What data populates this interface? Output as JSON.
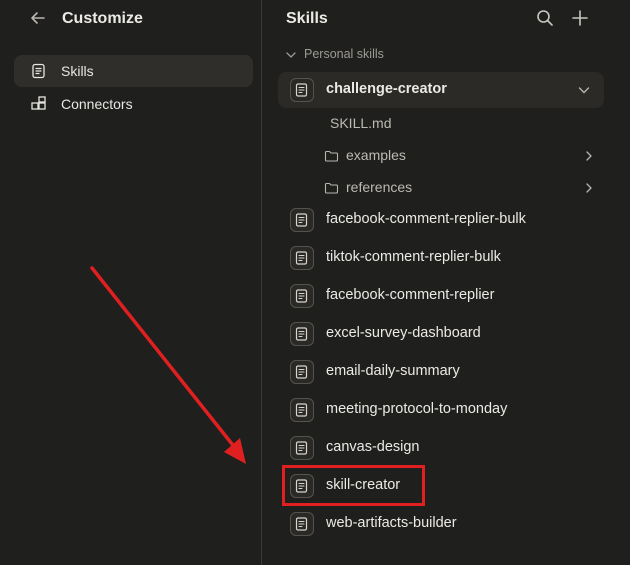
{
  "left_panel": {
    "title": "Customize",
    "nav": [
      {
        "label": "Skills",
        "icon": "skill-scroll-icon",
        "active": true
      },
      {
        "label": "Connectors",
        "icon": "connectors-icon",
        "active": false
      }
    ]
  },
  "right_panel": {
    "title": "Skills",
    "section_label": "Personal skills",
    "expanded_skill": {
      "label": "challenge-creator",
      "children": [
        {
          "label": "SKILL.md",
          "type": "file"
        },
        {
          "label": "examples",
          "type": "folder"
        },
        {
          "label": "references",
          "type": "folder"
        }
      ]
    },
    "skills": [
      "facebook-comment-replier-bulk",
      "tiktok-comment-replier-bulk",
      "facebook-comment-replier",
      "excel-survey-dashboard",
      "email-daily-summary",
      "meeting-protocol-to-monday",
      "canvas-design",
      "skill-creator",
      "web-artifacts-builder"
    ],
    "highlighted_skill": "skill-creator"
  },
  "colors": {
    "background": "#1f1f1e",
    "active_item": "#2f2e2b",
    "annotation_red": "#e02020",
    "text": "#eceae5",
    "muted_text": "#9c9a94"
  }
}
